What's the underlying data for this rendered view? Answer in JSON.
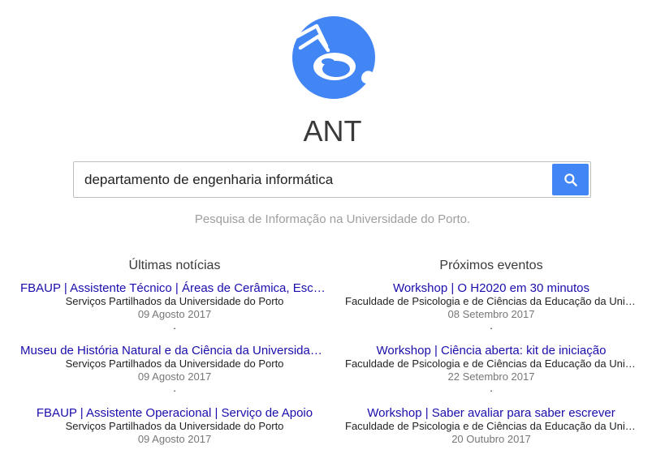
{
  "app": {
    "title": "ANT",
    "tagline": "Pesquisa de Informação na Universidade do Porto."
  },
  "search": {
    "value": "departamento de engenharia informática"
  },
  "colors": {
    "accent": "#4285f4",
    "link": "#1a0dab"
  },
  "icons": {
    "logo": "ant-head-logo",
    "search": "search-icon"
  },
  "news": {
    "heading": "Últimas notícias",
    "items": [
      {
        "title": "FBAUP | Assistente Técnico | Áreas de Cerâmica, Escultura e Desenho",
        "source": "Serviços Partilhados da Universidade do Porto",
        "date": "09 Agosto 2017",
        "sep": "."
      },
      {
        "title": "Museu de História Natural e da Ciência da Universidade do Porto",
        "source": "Serviços Partilhados da Universidade do Porto",
        "date": "09 Agosto 2017",
        "sep": "."
      },
      {
        "title": "FBAUP | Assistente Operacional | Serviço de Apoio",
        "source": "Serviços Partilhados da Universidade do Porto",
        "date": "09 Agosto 2017",
        "sep": ""
      }
    ]
  },
  "events": {
    "heading": "Próximos eventos",
    "items": [
      {
        "title": "Workshop | O H2020 em 30 minutos",
        "source": "Faculdade de Psicologia e de Ciências da Educação da Universidade do Porto",
        "date": "08 Setembro 2017",
        "sep": "."
      },
      {
        "title": "Workshop | Ciência aberta: kit de iniciação",
        "source": "Faculdade de Psicologia e de Ciências da Educação da Universidade do Porto",
        "date": "22 Setembro 2017",
        "sep": "."
      },
      {
        "title": "Workshop | Saber avaliar para saber escrever",
        "source": "Faculdade de Psicologia e de Ciências da Educação da Universidade do Porto",
        "date": "20 Outubro 2017",
        "sep": ""
      }
    ]
  }
}
